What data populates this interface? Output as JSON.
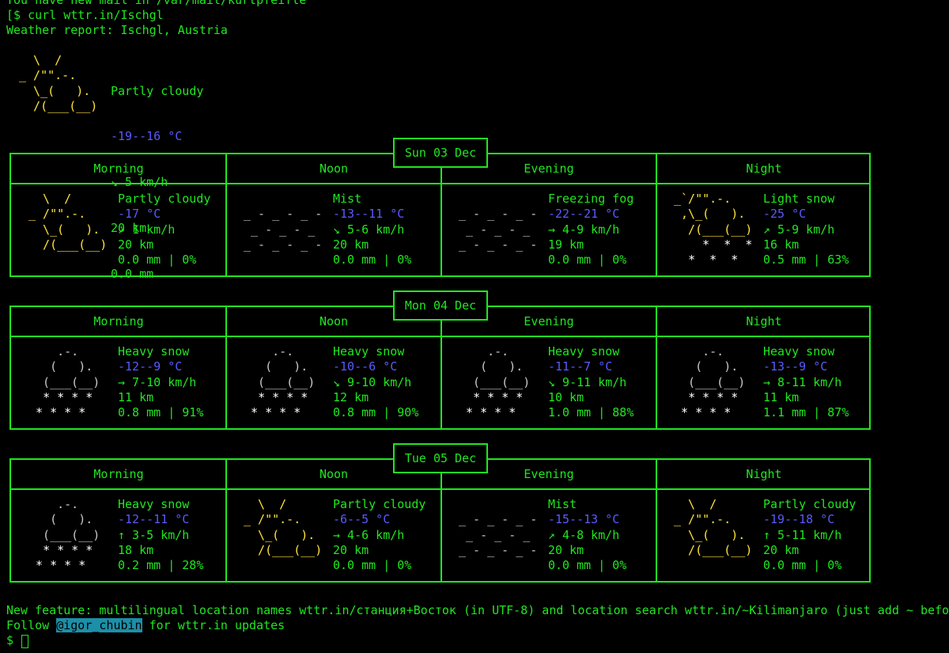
{
  "terminal": {
    "mail_notice": "You have new mail in /var/mail/kurtpfeifle",
    "command_line": "[$ curl wttr.in/Ischgl",
    "report_title": "Weather report: Ischgl, Austria",
    "footer_line1": "New feature: multilingual location names wttr.in/станция+Восток (in UTF-8) and location search wttr.in/~Kilimanjaro (just add ~ before)",
    "footer_follow": "Follow ",
    "footer_handle": "@igor_chubin",
    "footer_tail": " for wttr.in updates",
    "prompt": "$ "
  },
  "current": {
    "condition": "Partly cloudy",
    "temp": "-19--16 °C",
    "wind": "↘ 5 km/h",
    "visibility": "20 km",
    "precip": "0.0 mm",
    "art": "  \\  /      \n_ /\"\".-.   \n  \\_(   ). \n  /(___(__)"
  },
  "periods": [
    "Morning",
    "Noon",
    "Evening",
    "Night"
  ],
  "days": [
    {
      "label": "Sun 03 Dec",
      "cells": [
        {
          "art": "  \\  /      \n_ /\"\".-.   \n  \\_(   ). \n  /(___(__)",
          "art_type": "sun",
          "condition": "Partly cloudy",
          "temp": "-17 °C",
          "wind": "↗ 1 km/h",
          "vis": "20 km",
          "precip": "0.0 mm | 0%"
        },
        {
          "art": "           \n_ - _ - _ -\n _ - _ - _ \n_ - _ - _ -",
          "art_type": "fog",
          "condition": "Mist",
          "temp": "-13--11 °C",
          "wind": "↘ 5-6 km/h",
          "vis": "20 km",
          "precip": "0.0 mm | 0%"
        },
        {
          "art": "           \n_ - _ - _ -\n _ - _ - _ \n_ - _ - _ -",
          "art_type": "fog",
          "condition": "Freezing fog",
          "temp": "-22--21 °C",
          "wind": "→ 4-9 km/h",
          "vis": "19 km",
          "precip": "0.0 mm | 0%"
        },
        {
          "art": "_`/\"\".-.   \n ,\\_(   ). \n  /(___(__)\n    *  *  *\n  *  *  *  ",
          "art_type": "lightsnow",
          "condition": "Light snow",
          "temp": "-25 °C",
          "wind": "↗ 5-9 km/h",
          "vis": "16 km",
          "precip": "0.5 mm | 63%"
        }
      ]
    },
    {
      "label": "Mon 04 Dec",
      "cells": [
        {
          "art": "    .-.    \n   (   ).  \n  (___(__) \n  * * * *  \n * * * *   ",
          "art_type": "snow",
          "condition": "Heavy snow",
          "temp": "-12--9 °C",
          "wind": "→ 7-10 km/h",
          "vis": "11 km",
          "precip": "0.8 mm | 91%"
        },
        {
          "art": "    .-.    \n   (   ).  \n  (___(__) \n  * * * *  \n * * * *   ",
          "art_type": "snow",
          "condition": "Heavy snow",
          "temp": "-10--6 °C",
          "wind": "↘ 9-10 km/h",
          "vis": "12 km",
          "precip": "0.8 mm | 90%"
        },
        {
          "art": "    .-.    \n   (   ).  \n  (___(__) \n  * * * *  \n * * * *   ",
          "art_type": "snow",
          "condition": "Heavy snow",
          "temp": "-11--7 °C",
          "wind": "↘ 9-11 km/h",
          "vis": "10 km",
          "precip": "1.0 mm | 88%"
        },
        {
          "art": "    .-.    \n   (   ).  \n  (___(__) \n  * * * *  \n * * * *   ",
          "art_type": "snow",
          "condition": "Heavy snow",
          "temp": "-13--9 °C",
          "wind": "→ 8-11 km/h",
          "vis": "11 km",
          "precip": "1.1 mm | 87%"
        }
      ]
    },
    {
      "label": "Tue 05 Dec",
      "cells": [
        {
          "art": "    .-.    \n   (   ).  \n  (___(__) \n  * * * *  \n * * * *   ",
          "art_type": "snow",
          "condition": "Heavy snow",
          "temp": "-12--11 °C",
          "wind": "↑ 3-5 km/h",
          "vis": "18 km",
          "precip": "0.2 mm | 28%"
        },
        {
          "art": "  \\  /      \n_ /\"\".-.   \n  \\_(   ). \n  /(___(__)",
          "art_type": "sun",
          "condition": "Partly cloudy",
          "temp": "-6--5 °C",
          "wind": "→ 4-6 km/h",
          "vis": "20 km",
          "precip": "0.0 mm | 0%"
        },
        {
          "art": "           \n_ - _ - _ -\n _ - _ - _ \n_ - _ - _ -",
          "art_type": "fog",
          "condition": "Mist",
          "temp": "-15--13 °C",
          "wind": "↗ 4-8 km/h",
          "vis": "20 km",
          "precip": "0.0 mm | 0%"
        },
        {
          "art": "  \\  /      \n_ /\"\".-.   \n  \\_(   ). \n  /(___(__)",
          "art_type": "sun",
          "condition": "Partly cloudy",
          "temp": "-19--18 °C",
          "wind": "↑ 5-11 km/h",
          "vis": "20 km",
          "precip": "0.0 mm | 0%"
        }
      ]
    }
  ],
  "colors": {
    "terminal_green": "#20e620",
    "sun_yellow": "#ffe23c",
    "cloud_grey": "#c8c8c8",
    "snow_white": "#ffffff",
    "temp_blue": "#5a5aff",
    "link_highlight": "#1d8fa8"
  }
}
